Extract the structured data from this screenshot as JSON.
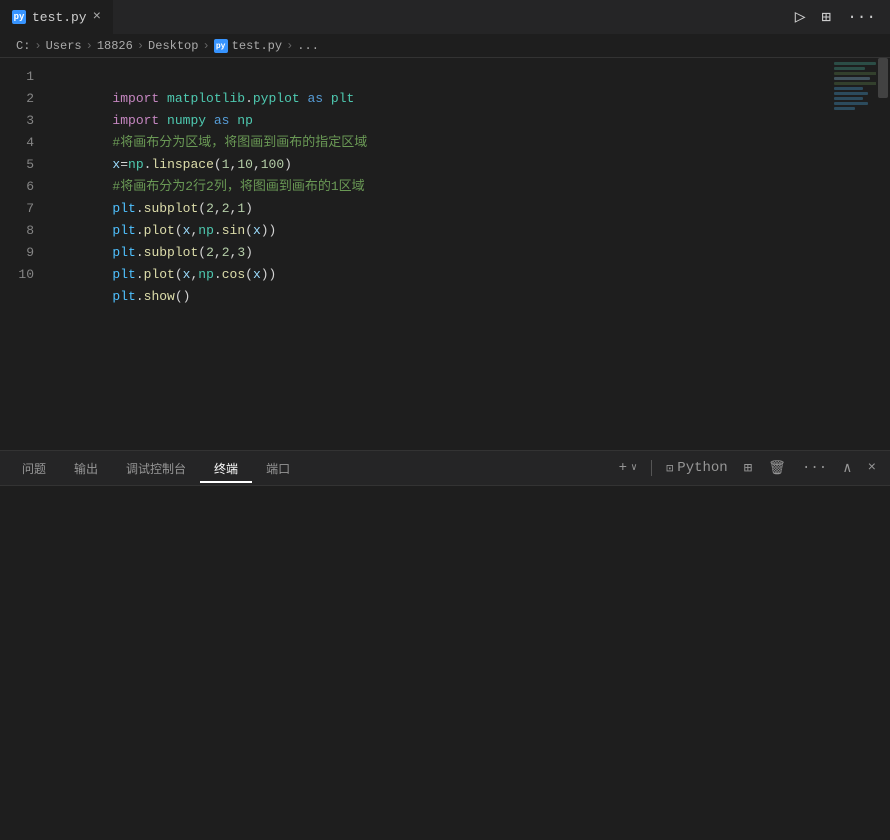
{
  "tab": {
    "icon_text": "py",
    "filename": "test.py",
    "close_label": "×"
  },
  "tab_bar_actions": {
    "run": "▷",
    "split": "⊞",
    "more": "···"
  },
  "breadcrumb": {
    "items": [
      "C:",
      "Users",
      "18826",
      "Desktop",
      "test.py",
      "..."
    ],
    "separators": [
      ">",
      ">",
      ">",
      ">",
      ">"
    ]
  },
  "code": {
    "lines": [
      {
        "num": "1",
        "content": "import matplotlib.pyplot as plt"
      },
      {
        "num": "2",
        "content": "import numpy as np"
      },
      {
        "num": "3",
        "content": "#将画布分为区域，将图画到画布的指定区域"
      },
      {
        "num": "4",
        "content": "x=np.linspace(1,10,100)"
      },
      {
        "num": "5",
        "content": "#将画布分为2行2列，将图画到画布的1区域"
      },
      {
        "num": "6",
        "content": "plt.subplot(2,2,1)"
      },
      {
        "num": "7",
        "content": "plt.plot(x,np.sin(x))"
      },
      {
        "num": "8",
        "content": "plt.subplot(2,2,3)"
      },
      {
        "num": "9",
        "content": "plt.plot(x,np.cos(x))"
      },
      {
        "num": "10",
        "content": "plt.show()"
      }
    ]
  },
  "panel": {
    "tabs": [
      {
        "label": "问题",
        "active": false
      },
      {
        "label": "输出",
        "active": false
      },
      {
        "label": "调试控制台",
        "active": false
      },
      {
        "label": "终端",
        "active": true
      },
      {
        "label": "端口",
        "active": false
      }
    ],
    "actions": {
      "add": "+",
      "dropdown": "∨",
      "terminal_icon": "⊡",
      "language": "Python",
      "split": "⊞",
      "trash": "🗑",
      "more": "···",
      "up": "∧",
      "close": "×"
    }
  }
}
